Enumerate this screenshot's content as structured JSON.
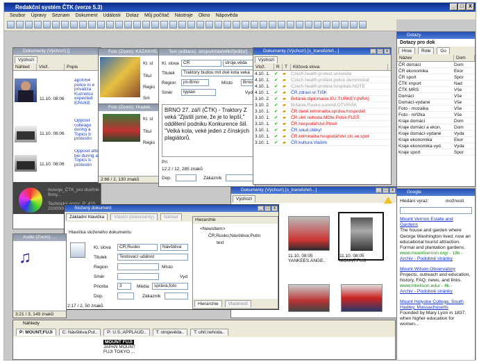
{
  "app": {
    "title": "Redakční systém ČTK (verze 5.3)",
    "menu": [
      "Soubor",
      "Úpravy",
      "Seznam",
      "Dokument",
      "Události",
      "Dotaz",
      "Můj počítač",
      "Nástroje",
      "Okno",
      "Nápověda"
    ]
  },
  "win_buttons": [
    "_",
    "□",
    "X"
  ],
  "pb": [
    "_",
    "□",
    "x"
  ],
  "panel_docs1": {
    "title": "Dokumenty (Výchozí) []",
    "tab": "Výchozí",
    "cols": [
      "Náhled",
      "Vlož.",
      "Popis"
    ],
    "rows": [
      {
        "time": "11.10. 08:06",
        "text": "ajp3054 police in e privatiza Kuznetso expected EPA/KE"
      },
      {
        "time": "11.10. 08:06",
        "text": "Opposit colleagu during a Topics b protestin"
      },
      {
        "time": "11.10. 08:06",
        "text": "Opposit after bei during a Topics b protestin"
      }
    ],
    "bottom": "rkovoje_ČTK_pro dceřiné firmy...",
    "bottom2": "Technický popis: P: 420 2030000"
  },
  "panel_foto1": {
    "title": "Foto (Zoom): KAZAKHS...",
    "lab1": "Kl. sl",
    "lab2": "Titul",
    "lab3": "Regio",
    "lab4": "Sm"
  },
  "panel_foto2": {
    "title": "Foto (Zoom): Hradek..",
    "lab1": "Kl. sl",
    "lab2": "Titul",
    "lab3": "Regio"
  },
  "panel_text": {
    "title": "Text (editace): strojovězda/vélkř/[editor]",
    "kl_label": "Kl. slova",
    "kl_val": "ČR",
    "kl_val2": "stroje,věda",
    "tit_label": "Titulek",
    "tit_val": "Traktory budou mít dvě kola veká",
    "reg_label": "Region",
    "reg_val": "jm-Brno",
    "misto_label": "Místo",
    "misto_val": "Brno",
    "smer_label": "Směr",
    "smer_val": "typlan",
    "vyd_label": "Vyd",
    "body": "BRNO 27. září (ČTK) - Traktory Z veká \"Zjistili jsme, že je to lepší,\" oddělení podniku Konkurence šiil. \"Velká kola, veké jeden z čínských plagiátorů.",
    "pri_label": "Pri",
    "stat": "12.2 / 12, 285 znaků",
    "dop_label": "Dop.",
    "zak_label": "Zákazník"
  },
  "panel_docs2": {
    "title": "Dokumenty (Výchozí) [s_transfořeň...]",
    "tab": "Výchozí",
    "cols": [
      "Vlož.",
      "R",
      "T",
      "Klíčová slova"
    ],
    "rows": [
      {
        "t": "4.10. 1.",
        "kw": "Czech.health.protest.univesita",
        "c": "gray"
      },
      {
        "t": "4.10. 1.",
        "kw": "Czech.health.protest.police.demonstrat",
        "c": "gray"
      },
      {
        "t": "4.10. 1.",
        "kw": "Czech.health.protest.hospitals.NOTE",
        "c": "gray"
      },
      {
        "t": "4.10. 1.",
        "kw": "ČR.zdraví.vr.TISK",
        "c": "blue"
      },
      {
        "t": "3.10. 2.",
        "kw": "Británie.diplomacie.EU.TURKEY.(NRA)",
        "c": "red"
      },
      {
        "t": "3.10. 2.",
        "kw": "Británie.Rusko.summit.OTVIRÁK",
        "c": "gray"
      },
      {
        "t": "3.10. 1.",
        "kw": "ČR.daně.kriminalita.správa.hospodář.",
        "c": "red"
      },
      {
        "t": "3.10. 1.",
        "kw": "ČR.uhlí.nehoda.MOte.Polsk.FLEŠ",
        "c": "red"
      },
      {
        "t": "3.10. 1.",
        "kw": "ČR.hospodářství.Plzeň",
        "c": "red"
      },
      {
        "t": "3.10. 1.",
        "kw": "ČR.soud.útěky!",
        "c": "blue"
      },
      {
        "t": "3.10. 1.",
        "kw": "ČR.kriminalita.hospodářství.clo.ve.spot",
        "c": "red"
      },
      {
        "t": "3.10. 1.",
        "kw": "ČR.kultura.Vlašim",
        "c": "blue"
      }
    ]
  },
  "panel_docs3": {
    "title": "Dokumenty (Výchozí) [s_transfořeň...]",
    "tab": "Výchozí",
    "thumbs": [
      {
        "cap": ""
      },
      {
        "cap": ""
      },
      {
        "cap": ""
      },
      {
        "cap": "11.10. 08:05 YANKEES.ANGE.."
      },
      {
        "cap": "11.10. 08:05 MOUNT.FUJI"
      },
      {
        "cap": ""
      },
      {
        "cap": ""
      },
      {
        "cap": ""
      }
    ]
  },
  "panel_slozeny": {
    "title": "Složený dokument",
    "tabs": [
      "Základní hlavička",
      "Vlastní (dokumenty)",
      "Náhled"
    ],
    "hlavicka": "Hlavička složeného dokumentu",
    "kl_label": "Kl. slova",
    "kl_val": "ČR;Rusko",
    "kl_val2": "Návštěva",
    "tit_label": "Titulek",
    "tit_val": "Testovací událost",
    "reg_label": "Region",
    "misto_label": "Místo",
    "smer_label": "Směr",
    "vyd_label": "Vyd",
    "pri_label": "Priorita",
    "pri_val": "3",
    "media_label": "Média",
    "media_val": "správa,foto",
    "dop_label": "Dop.",
    "zak_label": "Zákazník",
    "status": "2:17 / 2, 50 znaků",
    "hier_title": "Hierarchie",
    "hier_items": [
      "<NewsItem>",
      "ČR;Rusko;Návštěva;Putin",
      "text"
    ],
    "hier_tabs": [
      "Hierarchie",
      "Vlastnosti"
    ]
  },
  "panel_audio": {
    "title": "Audio (Zoom): ...",
    "status": "3:21 / 3, 149 znaků"
  },
  "panel_status1": "2:66 / 2, 130 znaků",
  "dotazy": {
    "title": "Dotazy",
    "inner_title": "Dotazy pro dok",
    "tabs": [
      "Hroe",
      "Role",
      "Go"
    ],
    "cols": [
      "Název",
      "Dom"
    ],
    "rows": [
      {
        "n": "ČR domácí",
        "d": "Dom"
      },
      {
        "n": "ČR ekonomika",
        "d": "Ekor"
      },
      {
        "n": "ČR sport",
        "d": "Spor"
      },
      {
        "n": "ČTK import",
        "d": "Nad"
      },
      {
        "n": "ČTK MRS",
        "d": "Vše"
      },
      {
        "n": "Domácí",
        "d": "Vše"
      },
      {
        "n": "Domácí-vydané",
        "d": "Vše"
      },
      {
        "n": "Foto - mozaika",
        "d": "Vše"
      },
      {
        "n": "Foto - mřížka",
        "d": "Vše"
      },
      {
        "n": "Kraje domácí",
        "d": "Dom"
      },
      {
        "n": "Kraje domácí a ekon.",
        "d": "Dom"
      },
      {
        "n": "Kraje domácí-vydané",
        "d": "Vyda"
      },
      {
        "n": "Kraje ekonomika",
        "d": "Ekor"
      },
      {
        "n": "Kraje ekonomika-vyd.",
        "d": "Vyda"
      },
      {
        "n": "Kraje sport",
        "d": "Spor"
      }
    ]
  },
  "google": {
    "title": "Google",
    "search_label": "Hledání výraz:",
    "option": "možnosti",
    "results": [
      {
        "title": "Mount Vernon Estate and Gardens",
        "text": "The house and garden where George Washington lived, now an educational tourist attraction. Formal and plantation gardens.",
        "url": "www.mountvernon.org/ - 18k -",
        "links": "Archiv - Podobné stránky"
      },
      {
        "title": "Mount Wilson Observatory",
        "text": "Projects, outreach and education, history, FAQ, news, and links.",
        "url": "www.mtwilson.edu/ - 4k -",
        "links": "Archiv - Podobné stránky"
      },
      {
        "title": "Mount Holyoke College, South Hadley, Massachusetts",
        "text": "Founded by Mary Lyon in 1837, when higher education for women...",
        "url": "",
        "links": ""
      }
    ]
  },
  "nahledy": {
    "title": "Náhledy",
    "tabs": [
      "P: MOUNT;FUJI",
      "C: Návštěva;Put..",
      "P: U.S.;APPLAUD..",
      "T: strojevěda..",
      "T: uhlí;nehoda.."
    ],
    "caption": "MOUNT FUJI",
    "caption2": "JAPAN MOUNT FUJI TOKYO ..."
  },
  "pravo_bottom": "www",
  "warn": "!"
}
